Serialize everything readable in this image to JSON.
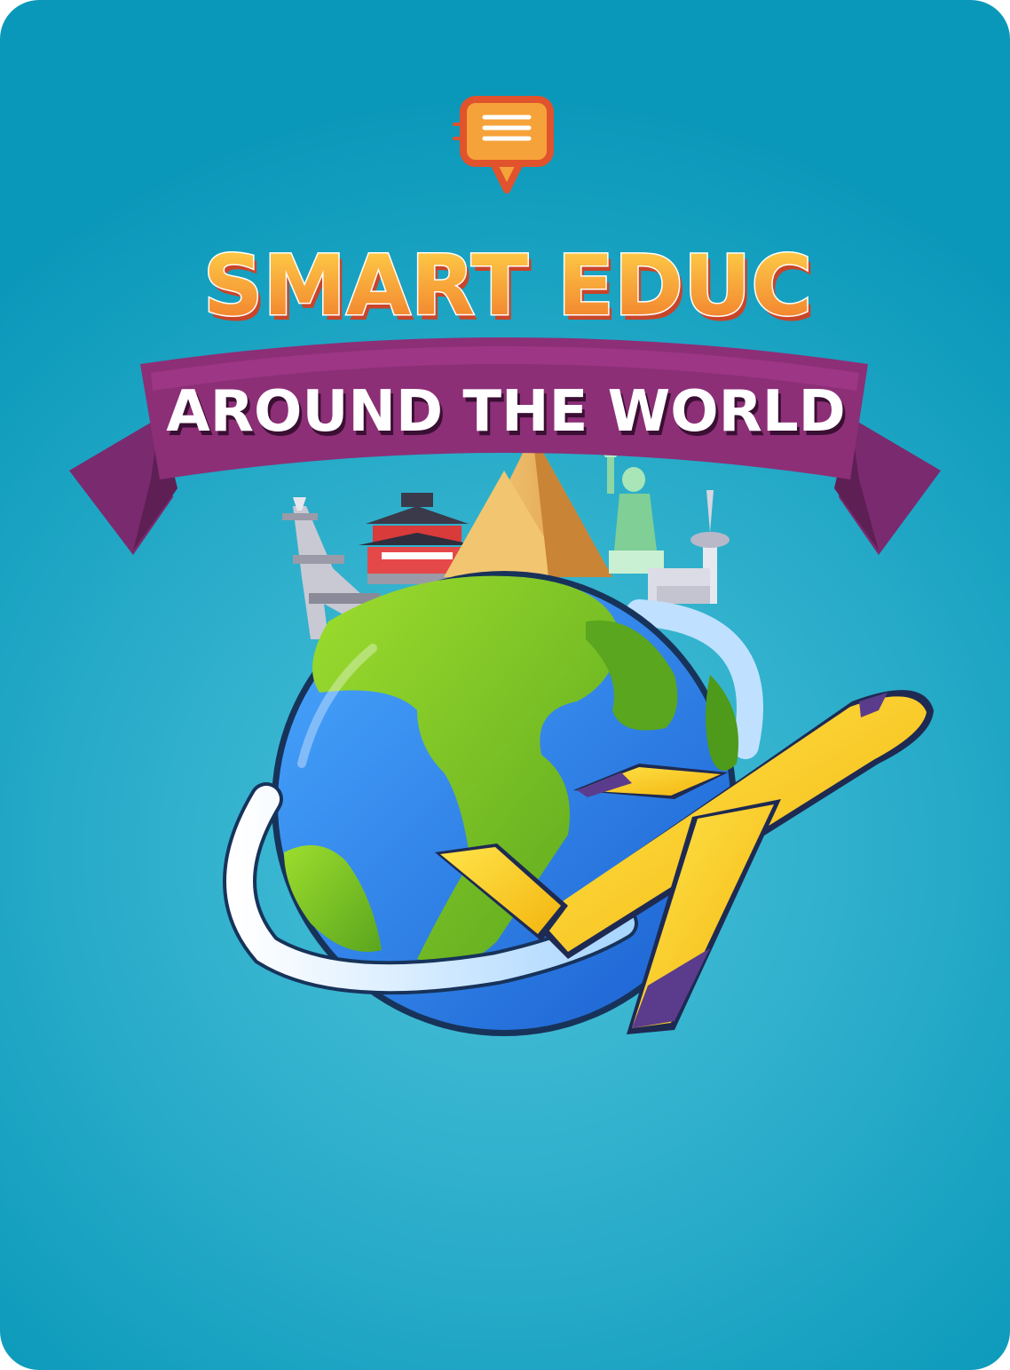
{
  "brand": {
    "icon": "chat-bubble-icon",
    "title": "SMART EDUC",
    "title_color": "#f28a2e",
    "title_highlight": "#ffcf4a"
  },
  "banner": {
    "text": "AROUND THE WORLD",
    "color": "#8c2f77",
    "text_color": "#ffffff"
  },
  "illustration": {
    "globe": "globe-icon",
    "airplane": "airplane-icon",
    "landmarks": [
      "eiffel-tower-icon",
      "pagoda-icon",
      "pyramids-icon",
      "statue-of-liberty-icon",
      "cn-tower-icon"
    ]
  },
  "colors": {
    "background": "#2fb0cc",
    "ocean": "#2d7fe6",
    "land": "#7cc42a",
    "plane": "#f5c81e",
    "plane_accent": "#5b3c8c"
  }
}
